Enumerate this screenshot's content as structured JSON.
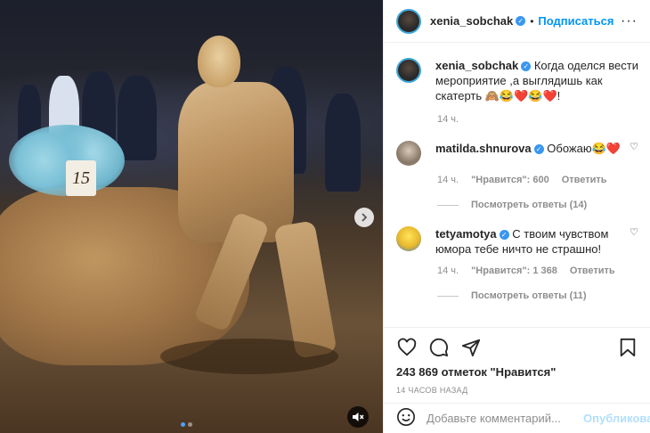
{
  "media": {
    "table_number": "15",
    "slide_count": 2,
    "active_slide": 0,
    "next_icon": "chevron-right-icon",
    "mute_icon": "speaker-muted-icon"
  },
  "header": {
    "username": "xenia_sobchak",
    "separator": "•",
    "follow_label": "Подписаться",
    "more_label": "···"
  },
  "caption": {
    "username": "xenia_sobchak",
    "text": "Когда оделся вести мероприятие ,а выглядишь как скатерть 🙈😂❤️😂❤️!",
    "time": "14 ч."
  },
  "comments": [
    {
      "username": "matilda.shnurova",
      "text": "Обожаю😂❤️",
      "time": "14 ч.",
      "likes": "\"Нравится\": 600",
      "reply_label": "Ответить",
      "view_replies": "Посмотреть ответы (14)"
    },
    {
      "username": "tetyamotya",
      "text": "С твоим чувством юмора тебе ничто не страшно!",
      "time": "14 ч.",
      "likes": "\"Нравится\": 1 368",
      "reply_label": "Ответить",
      "view_replies": "Посмотреть ответы (11)"
    }
  ],
  "actions": {
    "like_icon": "heart-icon",
    "comment_icon": "comment-icon",
    "share_icon": "share-icon",
    "save_icon": "bookmark-icon",
    "likes_count": "243 869 отметок \"Нравится\"",
    "time_ago": "14 ЧАСОВ НАЗАД"
  },
  "comment_box": {
    "placeholder": "Добавьте комментарий...",
    "publish_label": "Опубликовать"
  },
  "colors": {
    "accent": "#0095f6",
    "verified": "#3897f0",
    "heart": "#e0245e"
  }
}
